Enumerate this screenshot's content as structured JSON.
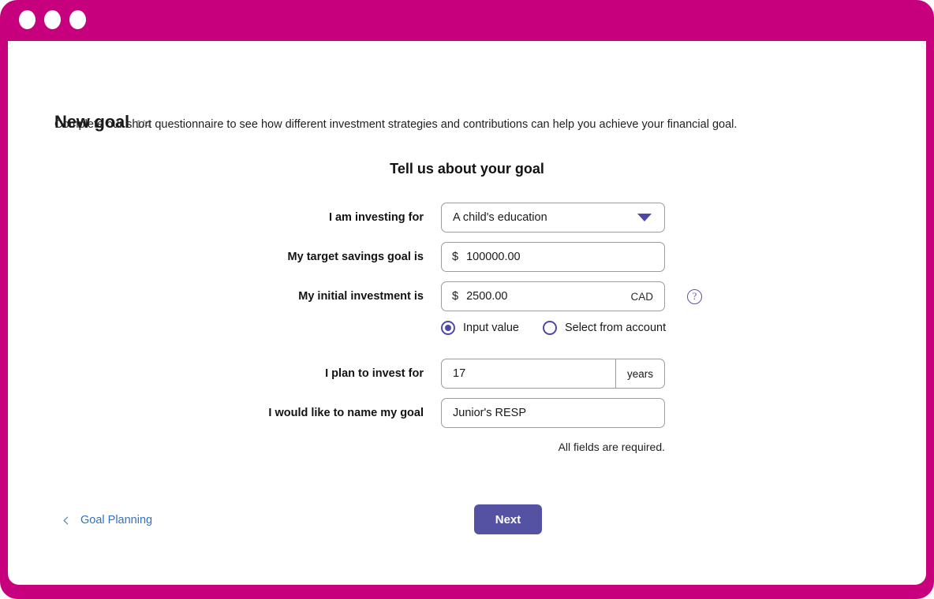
{
  "window": {
    "chrome_color": "#c7007d",
    "dots": [
      "window-dot-1",
      "window-dot-2",
      "window-dot-3"
    ]
  },
  "header": {
    "title": "New goal",
    "step": "1/4",
    "description": "Complete our short questionnaire to see how different investment strategies and contributions can help you achieve your financial goal."
  },
  "form": {
    "heading": "Tell us about your goal",
    "fields": [
      {
        "label": "I am investing for",
        "type": "select",
        "value": "A child's education",
        "icon": "chevron-down-icon"
      },
      {
        "label": "My target savings goal is",
        "type": "currency",
        "prefix": "$",
        "value": "100000.00"
      },
      {
        "label": "My initial investment is",
        "type": "currency",
        "prefix": "$",
        "value": "2500.00",
        "suffix": "CAD",
        "help_icon": "help-circle-icon"
      },
      {
        "label": "I plan to invest for",
        "type": "number",
        "value": "17",
        "suffix": "years"
      },
      {
        "label": "I would like to name my goal",
        "type": "text",
        "value": "Junior's RESP"
      }
    ],
    "radio_options": [
      {
        "label": "Input value",
        "selected": true
      },
      {
        "label": "Select from account",
        "selected": false
      }
    ],
    "note": "All fields are required."
  },
  "footer": {
    "back_label": "Goal Planning",
    "back_icon": "chevron-left-icon",
    "next_label": "Next",
    "next_color": "#5551a3"
  }
}
